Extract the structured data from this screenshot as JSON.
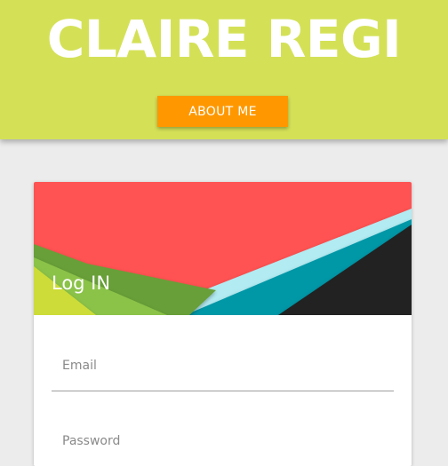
{
  "header": {
    "title": "CLAIRE REGI",
    "about_button_label": "ABOUT ME"
  },
  "login_card": {
    "title": "Log IN",
    "email_placeholder": "Email",
    "password_placeholder": "Password"
  },
  "colors": {
    "header_bg": "#d4e157",
    "about_button": "#ff9800",
    "banner_red": "#ff5252",
    "banner_light_blue": "#b2ebf2",
    "banner_teal": "#0097a7",
    "banner_dark": "#212121",
    "banner_green_dark": "#689f38",
    "banner_green": "#8bc34a",
    "banner_lime": "#cddc39"
  }
}
